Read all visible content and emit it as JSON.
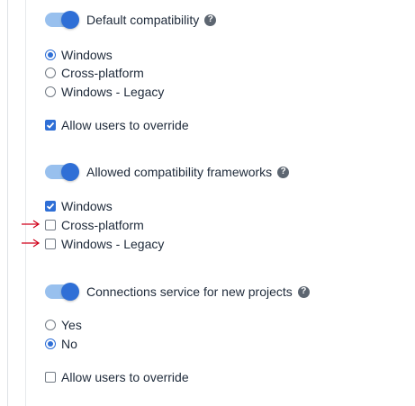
{
  "sections": [
    {
      "title": "Default compatibility",
      "options": [
        {
          "label": "Windows",
          "selected": true
        },
        {
          "label": "Cross-platform",
          "selected": false
        },
        {
          "label": "Windows - Legacy",
          "selected": false
        }
      ],
      "override": {
        "label": "Allow users to override",
        "checked": true
      }
    },
    {
      "title": "Allowed compatibility frameworks",
      "options": [
        {
          "label": "Windows",
          "checked": true
        },
        {
          "label": "Cross-platform",
          "checked": false
        },
        {
          "label": "Windows - Legacy",
          "checked": false
        }
      ]
    },
    {
      "title": "Connections service for new projects",
      "options": [
        {
          "label": "Yes",
          "selected": false
        },
        {
          "label": "No",
          "selected": true
        }
      ],
      "override": {
        "label": "Allow users to override",
        "checked": false
      }
    }
  ],
  "help_glyph": "?",
  "colors": {
    "accent": "#2f6fd6",
    "toggle_track": "#98c0ee",
    "annotation_arrow": "#d0021b"
  },
  "icons": {
    "help": "question-circle-icon",
    "arrow": "red-arrow-right-icon"
  }
}
